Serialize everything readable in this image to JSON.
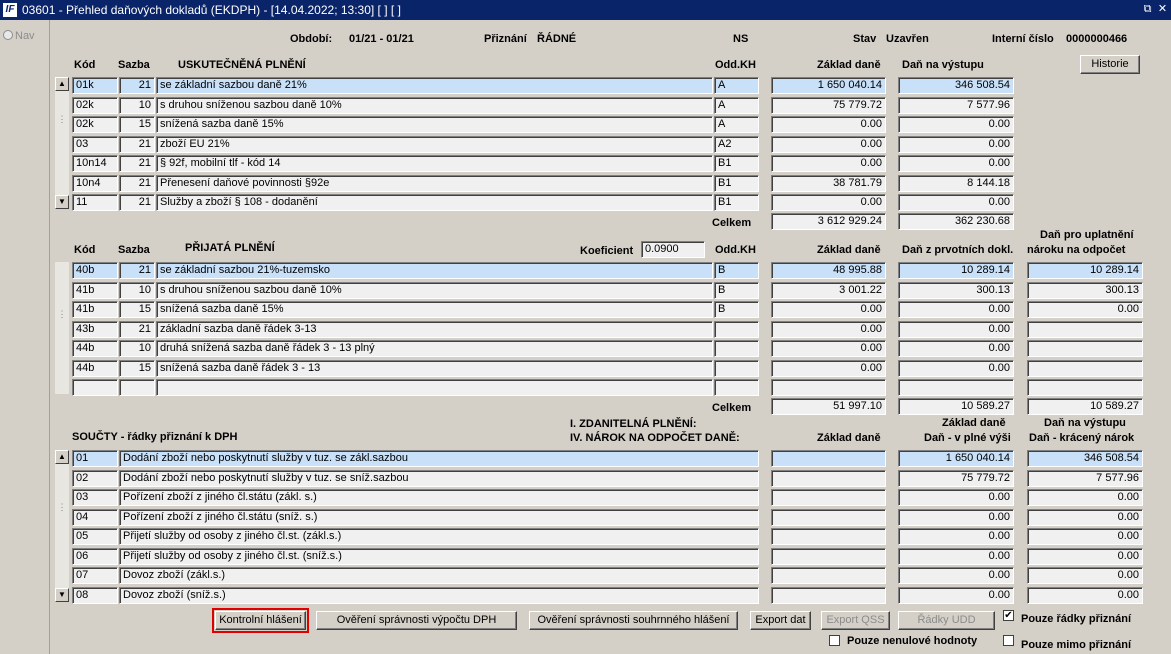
{
  "window": {
    "title": "03601 - Přehled daňových dokladů (EKDPH) - [14.04.2022; 13:30]  [ ]  [ ]",
    "logo": "IF",
    "restore_icon": "restore-icon",
    "close_icon": "close-icon"
  },
  "nav": {
    "label": "Nav"
  },
  "header": {
    "obdobi_label": "Období:",
    "obdobi_value": "01/21 - 01/21",
    "priznani_label": "Přiznání",
    "priznani_value": "ŘÁDNÉ",
    "ns_label": "NS",
    "stav_label": "Stav",
    "stav_value": "Uzavřen",
    "interni_label": "Interní číslo",
    "interni_value": "0000000466",
    "historie_button": "Historie"
  },
  "uskutecnena": {
    "col_kod": "Kód",
    "col_sazba": "Sazba",
    "col_title": "USKUTEČNĚNÁ PLNĚNÍ",
    "col_oddkh": "Odd.KH",
    "col_zaklad": "Základ daně",
    "col_dan": "Daň na výstupu",
    "rows": [
      {
        "kod": "01k",
        "sazba": "21",
        "popis": "se základní sazbou daně 21%",
        "odd": "A",
        "zaklad": "1 650 040.14",
        "dan": "346 508.54"
      },
      {
        "kod": "02k",
        "sazba": "10",
        "popis": "s druhou sníženou sazbou daně 10%",
        "odd": "A",
        "zaklad": "75 779.72",
        "dan": "7 577.96"
      },
      {
        "kod": "02k",
        "sazba": "15",
        "popis": "snížená sazba daně 15%",
        "odd": "A",
        "zaklad": "0.00",
        "dan": "0.00"
      },
      {
        "kod": "03",
        "sazba": "21",
        "popis": "zboží EU 21%",
        "odd": "A2",
        "zaklad": "0.00",
        "dan": "0.00"
      },
      {
        "kod": "10n14",
        "sazba": "21",
        "popis": "§ 92f, mobilní tlf - kód 14",
        "odd": "B1",
        "zaklad": "0.00",
        "dan": "0.00"
      },
      {
        "kod": "10n4",
        "sazba": "21",
        "popis": "Přenesení daňové povinnosti §92e",
        "odd": "B1",
        "zaklad": "38 781.79",
        "dan": "8 144.18"
      },
      {
        "kod": "11",
        "sazba": "21",
        "popis": "Služby a zboží § 108 - dodanění",
        "odd": "B1",
        "zaklad": "0.00",
        "dan": "0.00"
      }
    ],
    "celkem_label": "Celkem",
    "celkem_zaklad": "3 612 929.24",
    "celkem_dan": "362 230.68"
  },
  "prijata": {
    "col_kod": "Kód",
    "col_sazba": "Sazba",
    "col_title": "PŘIJATÁ PLNĚNÍ",
    "koef_label": "Koeficient",
    "koef_value": "0.0900",
    "col_oddkh": "Odd.KH",
    "col_zaklad": "Základ daně",
    "col_dan": "Daň z prvotních dokl.",
    "col_narok_1": "Daň pro uplatnění",
    "col_narok_2": "nároku na odpočet",
    "rows": [
      {
        "kod": "40b",
        "sazba": "21",
        "popis": "se základní sazbou 21%-tuzemsko",
        "odd": "B",
        "zaklad": "48 995.88",
        "dan": "10 289.14",
        "narok": "10 289.14"
      },
      {
        "kod": "41b",
        "sazba": "10",
        "popis": "s druhou sníženou sazbou daně 10%",
        "odd": "B",
        "zaklad": "3 001.22",
        "dan": "300.13",
        "narok": "300.13"
      },
      {
        "kod": "41b",
        "sazba": "15",
        "popis": "snížená sazba daně 15%",
        "odd": "B",
        "zaklad": "0.00",
        "dan": "0.00",
        "narok": "0.00"
      },
      {
        "kod": "43b",
        "sazba": "21",
        "popis": "základní sazba daně řádek 3-13",
        "odd": "",
        "zaklad": "0.00",
        "dan": "0.00",
        "narok": ""
      },
      {
        "kod": "44b",
        "sazba": "10",
        "popis": "druhá snížená sazba daně řádek 3 - 13 plný",
        "odd": "",
        "zaklad": "0.00",
        "dan": "0.00",
        "narok": ""
      },
      {
        "kod": "44b",
        "sazba": "15",
        "popis": "snížená sazba daně řádek 3 - 13",
        "odd": "",
        "zaklad": "0.00",
        "dan": "0.00",
        "narok": ""
      },
      {
        "kod": "",
        "sazba": "",
        "popis": "",
        "odd": "",
        "zaklad": "",
        "dan": "",
        "narok": ""
      }
    ],
    "celkem_label": "Celkem",
    "celkem_zaklad": "51 997.10",
    "celkem_dan": "10 589.27",
    "celkem_narok": "10 589.27"
  },
  "soucty": {
    "title": "SOUČTY - řádky přiznání k DPH",
    "hdr_1": "I. ZDANITELNÁ PLNĚNÍ:",
    "hdr_2": "IV. NÁROK NA ODPOČET DANĚ:",
    "col_zaklad": "Základ daně",
    "col_plna_1": "Základ daně",
    "col_plna_2": "Daň - v plné výši",
    "col_kracena_1": "Daň na výstupu",
    "col_kracena_2": "Daň - krácený nárok",
    "rows": [
      {
        "kod": "01",
        "popis": "Dodání zboží nebo poskytnutí služby v tuz. se zákl.sazbou",
        "zaklad": "",
        "plna": "1 650 040.14",
        "kracena": "346 508.54"
      },
      {
        "kod": "02",
        "popis": "Dodání zboží nebo poskytnutí služby v tuz. se sníž.sazbou",
        "zaklad": "",
        "plna": "75 779.72",
        "kracena": "7 577.96"
      },
      {
        "kod": "03",
        "popis": "Pořízení zboží z jiného čl.státu (zákl. s.)",
        "zaklad": "",
        "plna": "0.00",
        "kracena": "0.00"
      },
      {
        "kod": "04",
        "popis": "Pořízení zboží z jiného čl.státu (sníž. s.)",
        "zaklad": "",
        "plna": "0.00",
        "kracena": "0.00"
      },
      {
        "kod": "05",
        "popis": "Přijetí služby od osoby z jiného čl.st. (zákl.s.)",
        "zaklad": "",
        "plna": "0.00",
        "kracena": "0.00"
      },
      {
        "kod": "06",
        "popis": "Přijetí služby od osoby z jiného čl.st. (sníž.s.)",
        "zaklad": "",
        "plna": "0.00",
        "kracena": "0.00"
      },
      {
        "kod": "07",
        "popis": "Dovoz zboží (zákl.s.)",
        "zaklad": "",
        "plna": "0.00",
        "kracena": "0.00"
      },
      {
        "kod": "08",
        "popis": "Dovoz zboží (sníž.s.)",
        "zaklad": "",
        "plna": "0.00",
        "kracena": "0.00"
      }
    ]
  },
  "footer": {
    "btn_kontrolni": "Kontrolní hlášení",
    "btn_overeni_dph": "Ověření správnosti výpočtu DPH",
    "btn_overeni_souhrn": "Ověření správnosti souhrnného hlášení",
    "btn_export": "Export dat",
    "btn_export_qss": "Export QSS",
    "btn_radky_udd": "Řádky UDD",
    "chk_pouze_radky": "Pouze řádky přiznání",
    "chk_pouze_nenulove": "Pouze nenulové hodnoty",
    "chk_pouze_mimo": "Pouze mimo přiznání",
    "chk_pouze_radky_checked": true,
    "chk_pouze_nenulove_checked": false,
    "chk_pouze_mimo_checked": false
  }
}
